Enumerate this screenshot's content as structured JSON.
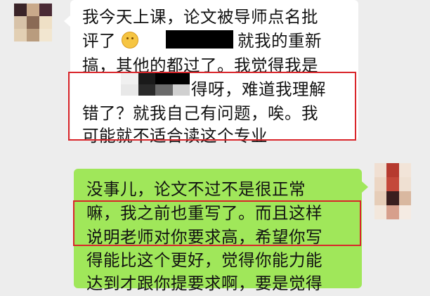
{
  "chat": {
    "incoming": {
      "lines": [
        "我今天上课，论文被导师点名批",
        "评了",
        "就我的重新",
        "搞，其他的都过了。我觉得我是",
        "得呀，难道我理解",
        "错了？就我自己有问题，唉。我",
        "可能就不适合读这个专业"
      ]
    },
    "outgoing": {
      "lines": [
        "没事儿，论文不过不是很正常",
        "嘛，我之前也重写了。而且这样",
        "说明老师对你要求高，希望你写",
        "得能比这个更好，觉得你能力能",
        "达到才跟你提要求啊，要是觉得"
      ]
    }
  },
  "icons": {
    "emoji": "smiling-face-emoji"
  },
  "colors": {
    "background": "#ededed",
    "incoming_bubble": "#ffffff",
    "outgoing_bubble": "#a0e75a",
    "highlight": "#d9252a"
  }
}
